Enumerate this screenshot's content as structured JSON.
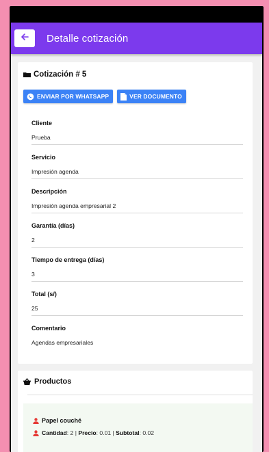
{
  "appbar": {
    "title": "Detalle cotización"
  },
  "quote": {
    "title": "Cotización # 5",
    "whatsapp_label": "ENVIAR POR WHATSAPP",
    "document_label": "VER DOCUMENTO"
  },
  "fields": [
    {
      "label": "Cliente",
      "value": "Prueba"
    },
    {
      "label": "Servicio",
      "value": "Impresión agenda"
    },
    {
      "label": "Descripción",
      "value": "Impresión agenda empresarial 2"
    },
    {
      "label": "Garantía (días)",
      "value": "2"
    },
    {
      "label": "Tiempo de entrega (días)",
      "value": "3"
    },
    {
      "label": "Total (s/)",
      "value": "25"
    },
    {
      "label": "Comentario",
      "value": "Agendas empresariales"
    }
  ],
  "products": {
    "title": "Productos",
    "items": [
      {
        "name": "Papel couché",
        "qty_label": "Cantidad",
        "qty": "2",
        "price_label": "Precio",
        "price": "0.01",
        "subtotal_label": "Subtotal",
        "subtotal": "0.02"
      }
    ]
  },
  "colors": {
    "primary": "#7c3aed",
    "button": "#3b82f6",
    "background": "#f48fb1",
    "person_icon": "#e53935"
  },
  "icons": [
    "back-arrow-icon",
    "folder-icon",
    "whatsapp-icon",
    "document-icon",
    "basket-icon",
    "person-icon"
  ]
}
